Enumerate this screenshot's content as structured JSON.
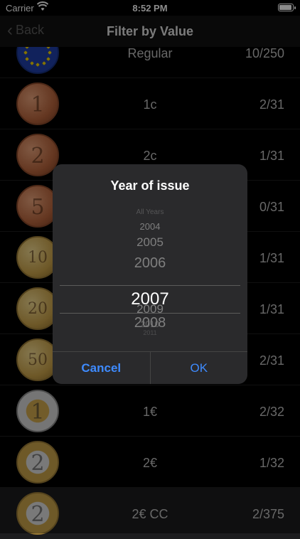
{
  "status_bar": {
    "carrier": "Carrier",
    "time": "8:52 PM"
  },
  "navbar": {
    "back_label": "Back",
    "title": "Filter by Value"
  },
  "rows": [
    {
      "label": "Regular",
      "count": "10/250",
      "coin": "eu-flag"
    },
    {
      "label": "1c",
      "count": "2/31",
      "coin": "1c"
    },
    {
      "label": "2c",
      "count": "1/31",
      "coin": "2c"
    },
    {
      "label": "5c",
      "count": "0/31",
      "coin": "5c"
    },
    {
      "label": "10c",
      "count": "1/31",
      "coin": "10c"
    },
    {
      "label": "20c",
      "count": "1/31",
      "coin": "20c"
    },
    {
      "label": "50c",
      "count": "2/31",
      "coin": "50c"
    },
    {
      "label": "1€",
      "count": "2/32",
      "coin": "1€"
    },
    {
      "label": "2€",
      "count": "1/32",
      "coin": "2€"
    },
    {
      "label": "2€ CC",
      "count": "2/375",
      "coin": "2€"
    }
  ],
  "dialog": {
    "title": "Year of issue",
    "picker_values": [
      "All Years",
      "2004",
      "2005",
      "2006",
      "2007",
      "2008",
      "2009",
      "2010",
      "2011"
    ],
    "selected_value": "2007",
    "cancel_label": "Cancel",
    "ok_label": "OK"
  },
  "colors": {
    "accent": "#3e8bff",
    "background": "#000000",
    "dialog": "#2a2a2c"
  }
}
